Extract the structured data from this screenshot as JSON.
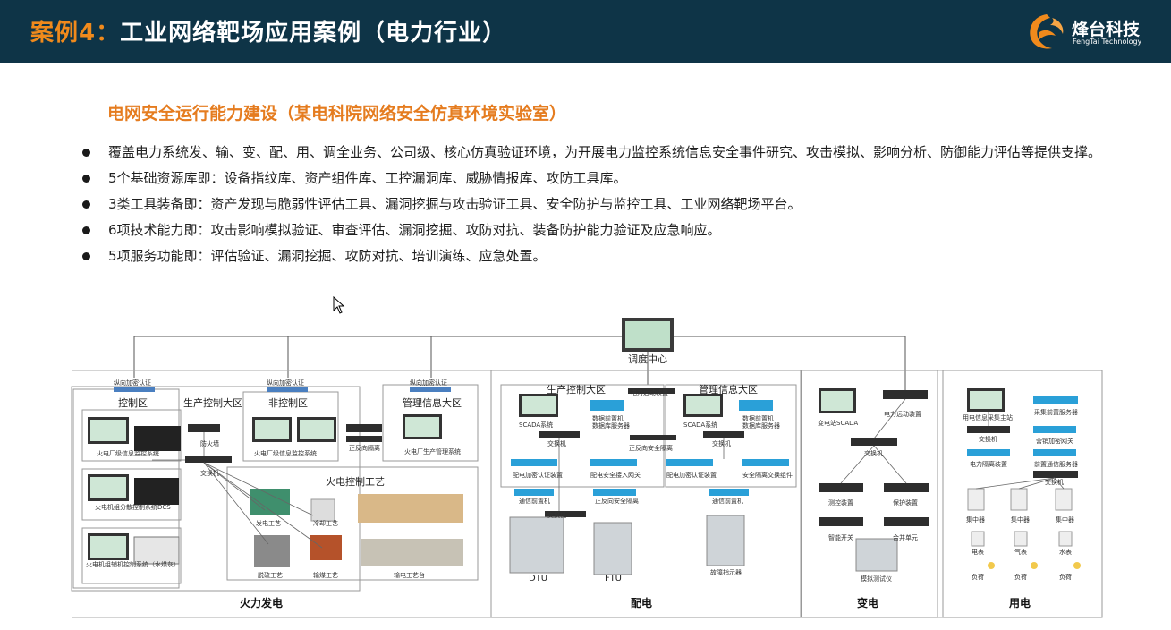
{
  "header": {
    "title_prefix": "案例4：",
    "title_main": "工业网络靶场应用案例（电力行业）",
    "logo_name": "烽台科技",
    "logo_en": "FengTai Technology",
    "logo_icon": "phoenix-logo-icon"
  },
  "subtitle": "电网安全运行能力建设（某电科院网络安全仿真环境实验室）",
  "bullets": [
    "覆盖电力系统发、输、变、配、用、调全业务、公司级、核心仿真验证环境，为开展电力监控系统信息安全事件研究、攻击模拟、影响分析、防御能力评估等提供支撑。",
    "5个基础资源库即：设备指纹库、资产组件库、工控漏洞库、威胁情报库、攻防工具库。",
    "3类工具装备即：资产发现与脆弱性评估工具、漏洞挖掘与攻击验证工具、安全防护与监控工具、工业网络靶场平台。",
    "6项技术能力即：攻击影响模拟验证、审查评估、漏洞挖掘、攻防对抗、装备防护能力验证及应急响应。",
    "5项服务功能即：评估验证、漏洞挖掘、攻防对抗、培训演练、应急处置。"
  ],
  "colors": {
    "header_bg": "#0e3447",
    "accent": "#f08a1c",
    "subtitle": "#e57c1f"
  },
  "diagram": {
    "dispatch": "调度中心",
    "gen": {
      "auth1": "纵向加密认证",
      "auth2": "纵向加密认证",
      "auth3": "纵向加密认证",
      "control_zone": "控制区",
      "prod_zone": "生产控制大区",
      "noncontrol_zone": "非控制区",
      "mgmt_zone": "管理信息大区",
      "sys1": "火电厂级信息监控系统",
      "sys2": "火电厂级信息监控系统",
      "sys3": "火电厂生产管理系统",
      "firewall": "防火墙",
      "isolation": "正反向隔离",
      "switch": "交换机",
      "dcs": "火电机组分散控制系统DCS",
      "aux": "火电机组辅机控制系统（水煤灰）",
      "process": "火电控制工艺",
      "p1": "发电工艺",
      "p2": "冷却工艺",
      "p3": "脱硫工艺",
      "p4": "输煤工艺",
      "p5": "输电工艺台",
      "label": "火力发电"
    },
    "dist": {
      "prod_zone": "生产控制大区",
      "mgmt_zone": "管理信息大区",
      "vpn": "电力远动装置",
      "scada1": "SCADA系统",
      "scada2": "SCADA系统",
      "db1a": "数据前置机",
      "db1b": "数据库服务器",
      "db2a": "数据前置机",
      "db2b": "数据库服务器",
      "switch1": "交换机",
      "switch2": "交换机",
      "switch3": "交换机",
      "isolation": "正反向安全隔离",
      "auth1": "配电加密认证装置",
      "access": "配电安全接入网关",
      "auth2": "配电加密认证装置",
      "safeswitch": "安全隔离交换组件",
      "comm1": "通信前置机",
      "isolation2": "正反向安全隔离",
      "comm2": "通信前置机",
      "dtu": "DTU",
      "ftu": "FTU",
      "fault": "故障指示器",
      "label": "配电"
    },
    "sub": {
      "scada": "变电站SCADA",
      "rtu": "电力远动装置",
      "switch": "交换机",
      "measure": "测控装置",
      "protect": "保护装置",
      "smart": "智能开关",
      "merge": "合并单元",
      "tester": "模拟测试仪",
      "label": "变电"
    },
    "use": {
      "master": "用电信息采集主站",
      "server": "采集前置服务器",
      "switch1": "交换机",
      "gateway": "营销加密网关",
      "isolation": "电力隔离装置",
      "comm": "前置通信服务器",
      "switch2": "交换机",
      "c1": "集中器",
      "c2": "集中器",
      "c3": "集中器",
      "m1": "电表",
      "m2": "气表",
      "m3": "水表",
      "l1": "负荷",
      "l2": "负荷",
      "l3": "负荷",
      "label": "用电"
    }
  }
}
